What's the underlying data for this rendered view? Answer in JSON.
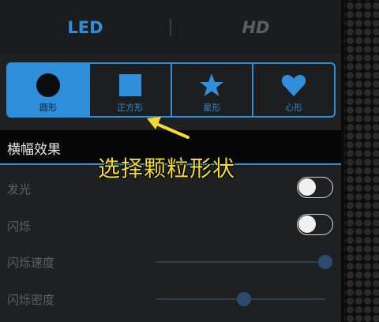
{
  "tabs": [
    {
      "label": "LED",
      "active": true
    },
    {
      "label": "HD",
      "active": false
    }
  ],
  "shape_picker": {
    "options": [
      {
        "label": "圆形",
        "icon": "circle-icon",
        "active": true
      },
      {
        "label": "正方形",
        "icon": "square-icon",
        "active": false
      },
      {
        "label": "星形",
        "icon": "star-icon",
        "active": false
      },
      {
        "label": "心形",
        "icon": "heart-icon",
        "active": false
      }
    ]
  },
  "section": {
    "title": "横幅效果"
  },
  "settings": {
    "glow": {
      "label": "发光",
      "on": false
    },
    "blink": {
      "label": "闪烁",
      "on": false
    },
    "blink_speed": {
      "label": "闪烁速度",
      "value_fraction": 1.0
    },
    "blink_density": {
      "label": "闪烁密度",
      "value_fraction": 0.52
    }
  },
  "annotation": {
    "text": "选择颗粒形状"
  },
  "colors": {
    "accent": "#2d8fdc",
    "annotation": "#f3dc2e",
    "background": "#1f2022"
  }
}
